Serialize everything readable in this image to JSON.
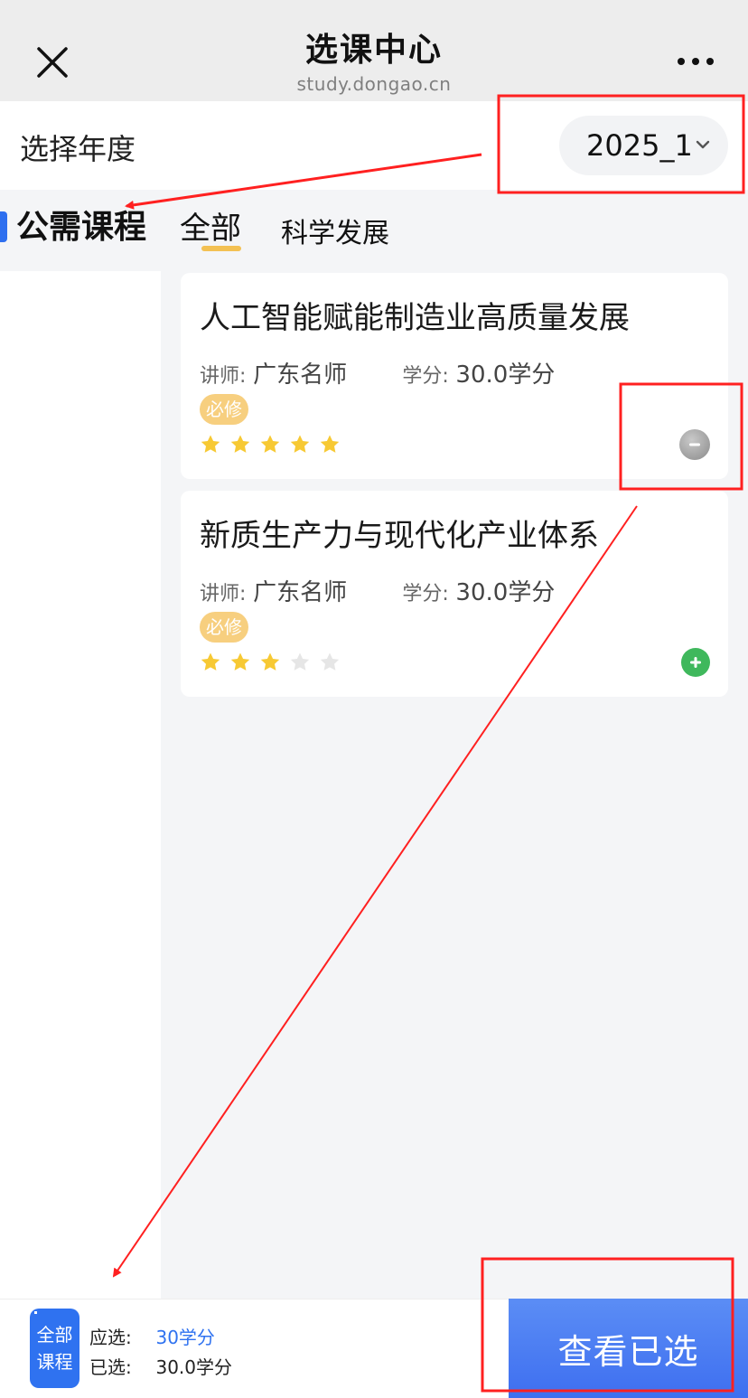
{
  "header": {
    "title": "选课中心",
    "subtitle": "study.dongao.cn",
    "close_icon": "close-icon",
    "more_icon": "more-dots-icon"
  },
  "year": {
    "label": "选择年度",
    "selected": "2025_1"
  },
  "category": {
    "title": "公需课程",
    "tabs": [
      {
        "label": "全部",
        "active": true
      },
      {
        "label": "科学发展",
        "active": false
      }
    ]
  },
  "courses": [
    {
      "title": "人工智能赋能制造业高质量发展",
      "teacher_label": "讲师:",
      "teacher": "广东名师",
      "credit_label": "学分:",
      "credit": "30.0学分",
      "tag": "必修",
      "rating": 5,
      "action": "remove"
    },
    {
      "title": "新质生产力与现代化产业体系",
      "teacher_label": "讲师:",
      "teacher": "广东名师",
      "credit_label": "学分:",
      "credit": "30.0学分",
      "tag": "必修",
      "rating": 3,
      "action": "add"
    }
  ],
  "footer": {
    "badge_line1": "全部",
    "badge_line2": "课程",
    "required_label": "应选:",
    "required_value": "30学分",
    "selected_label": "已选:",
    "selected_value": "30.0学分",
    "view_button": "查看已选"
  },
  "colors": {
    "accent": "#2f72f0",
    "tag": "#f7cf7f",
    "star_on": "#f7c934",
    "star_off": "#e6e6e6",
    "add": "#3fb85c",
    "annotation": "#ff2020"
  }
}
